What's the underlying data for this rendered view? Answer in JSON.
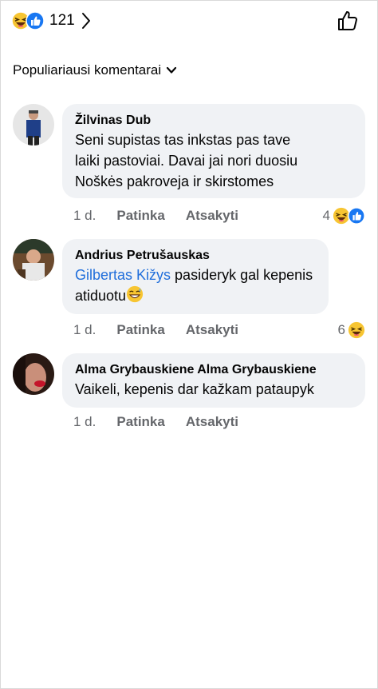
{
  "header": {
    "reaction_icons": [
      "haha-icon",
      "like-icon"
    ],
    "reaction_count": "121",
    "like_button_icon": "thumbs-up-icon"
  },
  "sort": {
    "label": "Populiariausi komentarai"
  },
  "comments": [
    {
      "author": "Žilvinas Dub",
      "text_lines": [
        "Seni supistas tas inkstas pas tave",
        "laiki pastoviai. Davai jai nori duosiu",
        "Noškės pakroveja ir skirstomes"
      ],
      "time": "1 d.",
      "like_label": "Patinka",
      "reply_label": "Atsakyti",
      "reaction_count": "4",
      "reactions": [
        "haha-icon",
        "like-icon"
      ]
    },
    {
      "author": "Andrius Petrušauskas",
      "mention": "Gilbertas Kižys",
      "text_line1": " pasideryk gal kepenis",
      "text_line2": "atiduotu",
      "inline_emoji": "grinning-sweat-emoji",
      "time": "1 d.",
      "like_label": "Patinka",
      "reply_label": "Atsakyti",
      "reaction_count": "6",
      "reactions": [
        "haha-icon"
      ]
    },
    {
      "author": "Alma Grybauskiene Alma Grybauskiene",
      "text": "Vaikeli, kepenis dar kažkam pataupyk",
      "time": "1 d.",
      "like_label": "Patinka",
      "reply_label": "Atsakyti"
    }
  ],
  "colors": {
    "mention": "#216fdb",
    "bubble": "#f0f2f5",
    "meta": "#65676b",
    "like_blue": "#1877f2",
    "haha_yellow": "#f7c532"
  }
}
